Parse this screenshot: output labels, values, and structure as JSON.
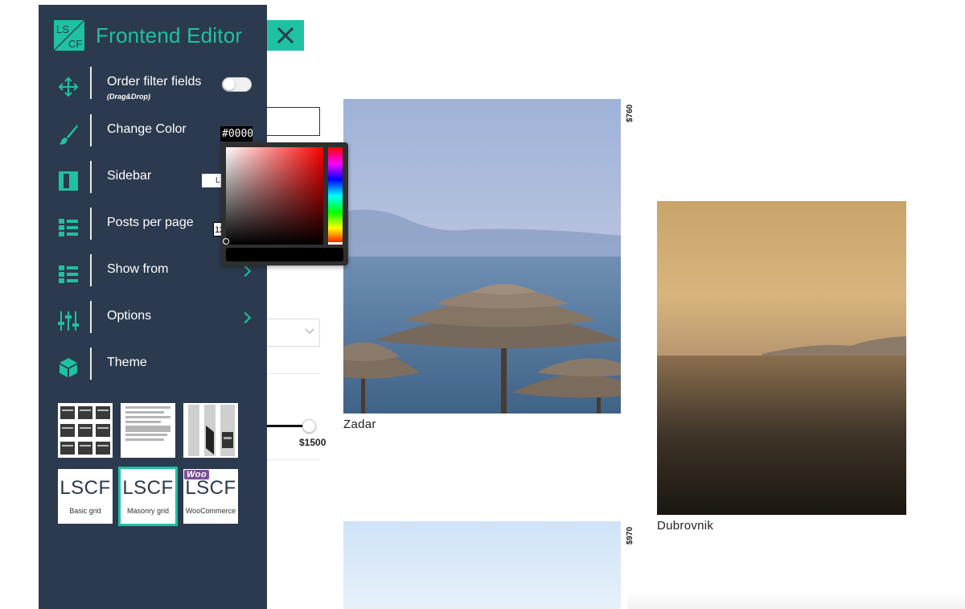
{
  "editor": {
    "logo_text": "LSCF",
    "title": "Frontend Editor",
    "menu": [
      {
        "label": "Order filter fields",
        "sublabel": "(Drag&Drop)",
        "icon": "move-arrows-icon"
      },
      {
        "label": "Change Color",
        "icon": "paintbrush-icon"
      },
      {
        "label": "Sidebar",
        "icon": "sidebar-layout-icon"
      },
      {
        "label": "Posts per page",
        "icon": "list-icon"
      },
      {
        "label": "Show from",
        "icon": "list-icon"
      },
      {
        "label": "Options",
        "icon": "sliders-icon"
      },
      {
        "label": "Theme",
        "icon": "cube-icon"
      }
    ],
    "color_value": "#0000",
    "sidebar_value": "L",
    "posts_per_page_value": "12",
    "theme_options": [
      {
        "word": "LSCF",
        "caption": "Basic grid"
      },
      {
        "word": "LSCF",
        "caption": "Masonry grid"
      },
      {
        "word": "LSCF",
        "caption": "WooCommerce",
        "badge": "Woo"
      }
    ],
    "accent_color": "#1fc1a3",
    "panel_color": "#2b3a4e"
  },
  "filter": {
    "price_max": "$1500"
  },
  "posts": [
    {
      "title": "Zadar",
      "price": "$760"
    },
    {
      "title": "Dubrovnik",
      "price": ""
    },
    {
      "title": "",
      "price": "$970"
    }
  ]
}
